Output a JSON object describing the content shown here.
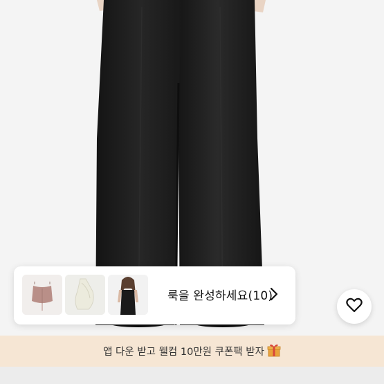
{
  "look_card": {
    "label": "룩을 완성하세요(10)",
    "thumbnails": [
      "pink-corset-top-thumbnail",
      "cream-halter-top-thumbnail",
      "model-black-camisole-thumbnail"
    ],
    "chevron": "chevron-right-icon"
  },
  "wishlist": {
    "icon": "heart-icon"
  },
  "promo_banner": {
    "text": "앱 다운 받고 웰컴 10만원 쿠폰팩 받자",
    "icon": "gift-icon",
    "background": "#f6e6d4"
  },
  "colors": {
    "pants": "#1c1c1c",
    "photo_background": "#f4f4f4",
    "card_background": "#ffffff"
  }
}
